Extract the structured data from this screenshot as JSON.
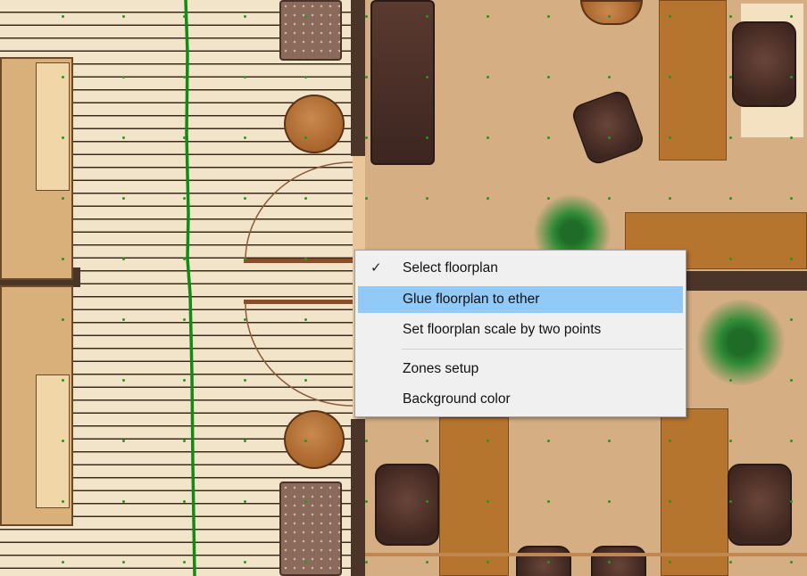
{
  "context_menu": {
    "items": [
      {
        "label": "Select floorplan",
        "checked": true,
        "highlighted": false
      },
      {
        "label": "Glue floorplan to ether",
        "checked": false,
        "highlighted": true
      },
      {
        "label": "Set floorplan scale by two points",
        "checked": false,
        "highlighted": false
      },
      {
        "label": "Zones setup",
        "checked": false,
        "highlighted": false
      },
      {
        "label": "Background color",
        "checked": false,
        "highlighted": false
      }
    ],
    "check_glyph": "✓",
    "highlight_color": "#91c9f7"
  },
  "floorplan": {
    "track_color": "#138a13",
    "grid_point_color": "#1e9a1e"
  }
}
